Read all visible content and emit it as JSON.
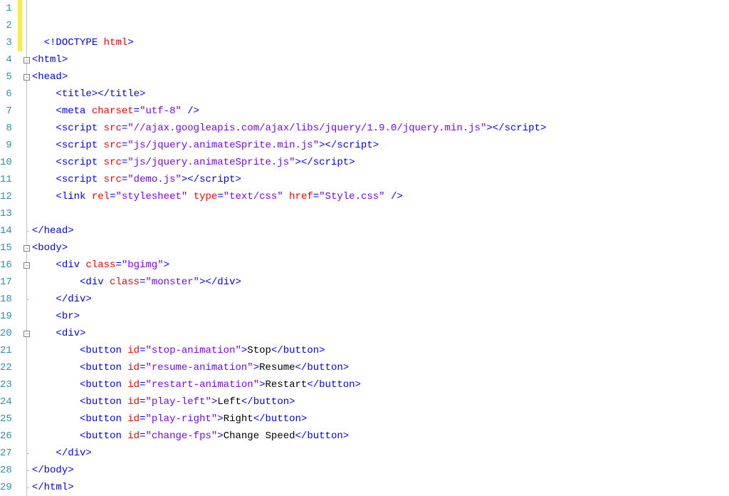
{
  "lines": [
    {
      "num": "1",
      "marker": true,
      "fold": "",
      "tokens": [
        {
          "c": "txt",
          "t": ""
        }
      ]
    },
    {
      "num": "2",
      "marker": true,
      "fold": "",
      "tokens": [
        {
          "c": "txt",
          "t": ""
        }
      ]
    },
    {
      "num": "3",
      "marker": true,
      "fold": "",
      "tokens": [
        {
          "c": "txt",
          "t": "  "
        },
        {
          "c": "doctype1",
          "t": "<!DOCTYPE "
        },
        {
          "c": "doctype2",
          "t": "html"
        },
        {
          "c": "doctype1",
          "t": ">"
        }
      ]
    },
    {
      "num": "4",
      "marker": false,
      "fold": "box",
      "tokens": [
        {
          "c": "tag",
          "t": "<html>"
        }
      ]
    },
    {
      "num": "5",
      "marker": false,
      "fold": "box",
      "tokens": [
        {
          "c": "tag",
          "t": "<head>"
        }
      ]
    },
    {
      "num": "6",
      "marker": false,
      "fold": "",
      "tokens": [
        {
          "c": "txt",
          "t": "    "
        },
        {
          "c": "tag",
          "t": "<title></title>"
        }
      ]
    },
    {
      "num": "7",
      "marker": false,
      "fold": "",
      "tokens": [
        {
          "c": "txt",
          "t": "    "
        },
        {
          "c": "tag",
          "t": "<meta "
        },
        {
          "c": "attr",
          "t": "charset"
        },
        {
          "c": "tag",
          "t": "="
        },
        {
          "c": "val",
          "t": "\"utf-8\""
        },
        {
          "c": "tag",
          "t": " />"
        }
      ]
    },
    {
      "num": "8",
      "marker": false,
      "fold": "",
      "tokens": [
        {
          "c": "txt",
          "t": "    "
        },
        {
          "c": "tag",
          "t": "<script "
        },
        {
          "c": "attr",
          "t": "src"
        },
        {
          "c": "tag",
          "t": "="
        },
        {
          "c": "val",
          "t": "\"//ajax.googleapis.com/ajax/libs/jquery/1.9.0/jquery.min.js\""
        },
        {
          "c": "tag",
          "t": "></script"
        },
        {
          "c": "tag",
          "t": ">"
        }
      ]
    },
    {
      "num": "9",
      "marker": false,
      "fold": "",
      "tokens": [
        {
          "c": "txt",
          "t": "    "
        },
        {
          "c": "tag",
          "t": "<script "
        },
        {
          "c": "attr",
          "t": "src"
        },
        {
          "c": "tag",
          "t": "="
        },
        {
          "c": "val",
          "t": "\"js/jquery.animateSprite.min.js\""
        },
        {
          "c": "tag",
          "t": "></script"
        },
        {
          "c": "tag",
          "t": ">"
        }
      ]
    },
    {
      "num": "10",
      "marker": false,
      "fold": "",
      "tokens": [
        {
          "c": "txt",
          "t": "    "
        },
        {
          "c": "tag",
          "t": "<script "
        },
        {
          "c": "attr",
          "t": "src"
        },
        {
          "c": "tag",
          "t": "="
        },
        {
          "c": "val",
          "t": "\"js/jquery.animateSprite.js\""
        },
        {
          "c": "tag",
          "t": "></script"
        },
        {
          "c": "tag",
          "t": ">"
        }
      ]
    },
    {
      "num": "11",
      "marker": false,
      "fold": "",
      "tokens": [
        {
          "c": "txt",
          "t": "    "
        },
        {
          "c": "tag",
          "t": "<script "
        },
        {
          "c": "attr",
          "t": "src"
        },
        {
          "c": "tag",
          "t": "="
        },
        {
          "c": "val",
          "t": "\"demo.js\""
        },
        {
          "c": "tag",
          "t": "></script"
        },
        {
          "c": "tag",
          "t": ">"
        }
      ]
    },
    {
      "num": "12",
      "marker": false,
      "fold": "",
      "tokens": [
        {
          "c": "txt",
          "t": "    "
        },
        {
          "c": "tag",
          "t": "<link "
        },
        {
          "c": "attr",
          "t": "rel"
        },
        {
          "c": "tag",
          "t": "="
        },
        {
          "c": "val",
          "t": "\"stylesheet\""
        },
        {
          "c": "tag",
          "t": " "
        },
        {
          "c": "attr",
          "t": "type"
        },
        {
          "c": "tag",
          "t": "="
        },
        {
          "c": "val",
          "t": "\"text/css\""
        },
        {
          "c": "tag",
          "t": " "
        },
        {
          "c": "attr",
          "t": "href"
        },
        {
          "c": "tag",
          "t": "="
        },
        {
          "c": "val",
          "t": "\"Style.css\""
        },
        {
          "c": "tag",
          "t": " />"
        }
      ]
    },
    {
      "num": "13",
      "marker": false,
      "fold": "",
      "tokens": [
        {
          "c": "txt",
          "t": ""
        }
      ]
    },
    {
      "num": "14",
      "marker": false,
      "fold": "end",
      "tokens": [
        {
          "c": "tag",
          "t": "</head>"
        }
      ]
    },
    {
      "num": "15",
      "marker": false,
      "fold": "box",
      "tokens": [
        {
          "c": "tag",
          "t": "<body>"
        }
      ]
    },
    {
      "num": "16",
      "marker": false,
      "fold": "box",
      "tokens": [
        {
          "c": "txt",
          "t": "    "
        },
        {
          "c": "tag",
          "t": "<div "
        },
        {
          "c": "attr",
          "t": "class"
        },
        {
          "c": "tag",
          "t": "="
        },
        {
          "c": "val",
          "t": "\"bgimg\""
        },
        {
          "c": "tag",
          "t": ">"
        }
      ]
    },
    {
      "num": "17",
      "marker": false,
      "fold": "",
      "tokens": [
        {
          "c": "txt",
          "t": "        "
        },
        {
          "c": "tag",
          "t": "<div "
        },
        {
          "c": "attr",
          "t": "class"
        },
        {
          "c": "tag",
          "t": "="
        },
        {
          "c": "val",
          "t": "\"monster\""
        },
        {
          "c": "tag",
          "t": "></div>"
        }
      ]
    },
    {
      "num": "18",
      "marker": false,
      "fold": "end",
      "tokens": [
        {
          "c": "txt",
          "t": "    "
        },
        {
          "c": "tag",
          "t": "</div>"
        }
      ]
    },
    {
      "num": "19",
      "marker": false,
      "fold": "",
      "tokens": [
        {
          "c": "txt",
          "t": "    "
        },
        {
          "c": "tag",
          "t": "<br>"
        }
      ]
    },
    {
      "num": "20",
      "marker": false,
      "fold": "box",
      "tokens": [
        {
          "c": "txt",
          "t": "    "
        },
        {
          "c": "tag",
          "t": "<div>"
        }
      ]
    },
    {
      "num": "21",
      "marker": false,
      "fold": "",
      "tokens": [
        {
          "c": "txt",
          "t": "        "
        },
        {
          "c": "tag",
          "t": "<button "
        },
        {
          "c": "attr",
          "t": "id"
        },
        {
          "c": "tag",
          "t": "="
        },
        {
          "c": "val",
          "t": "\"stop-animation\""
        },
        {
          "c": "tag",
          "t": ">"
        },
        {
          "c": "txt",
          "t": "Stop"
        },
        {
          "c": "tag",
          "t": "</button>"
        }
      ]
    },
    {
      "num": "22",
      "marker": false,
      "fold": "",
      "tokens": [
        {
          "c": "txt",
          "t": "        "
        },
        {
          "c": "tag",
          "t": "<button "
        },
        {
          "c": "attr",
          "t": "id"
        },
        {
          "c": "tag",
          "t": "="
        },
        {
          "c": "val",
          "t": "\"resume-animation\""
        },
        {
          "c": "tag",
          "t": ">"
        },
        {
          "c": "txt",
          "t": "Resume"
        },
        {
          "c": "tag",
          "t": "</button>"
        }
      ]
    },
    {
      "num": "23",
      "marker": false,
      "fold": "",
      "tokens": [
        {
          "c": "txt",
          "t": "        "
        },
        {
          "c": "tag",
          "t": "<button "
        },
        {
          "c": "attr",
          "t": "id"
        },
        {
          "c": "tag",
          "t": "="
        },
        {
          "c": "val",
          "t": "\"restart-animation\""
        },
        {
          "c": "tag",
          "t": ">"
        },
        {
          "c": "txt",
          "t": "Restart"
        },
        {
          "c": "tag",
          "t": "</button>"
        }
      ]
    },
    {
      "num": "24",
      "marker": false,
      "fold": "",
      "tokens": [
        {
          "c": "txt",
          "t": "        "
        },
        {
          "c": "tag",
          "t": "<button "
        },
        {
          "c": "attr",
          "t": "id"
        },
        {
          "c": "tag",
          "t": "="
        },
        {
          "c": "val",
          "t": "\"play-left\""
        },
        {
          "c": "tag",
          "t": ">"
        },
        {
          "c": "txt",
          "t": "Left"
        },
        {
          "c": "tag",
          "t": "</button>"
        }
      ]
    },
    {
      "num": "25",
      "marker": false,
      "fold": "",
      "tokens": [
        {
          "c": "txt",
          "t": "        "
        },
        {
          "c": "tag",
          "t": "<button "
        },
        {
          "c": "attr",
          "t": "id"
        },
        {
          "c": "tag",
          "t": "="
        },
        {
          "c": "val",
          "t": "\"play-right\""
        },
        {
          "c": "tag",
          "t": ">"
        },
        {
          "c": "txt",
          "t": "Right"
        },
        {
          "c": "tag",
          "t": "</button>"
        }
      ]
    },
    {
      "num": "26",
      "marker": false,
      "fold": "",
      "tokens": [
        {
          "c": "txt",
          "t": "        "
        },
        {
          "c": "tag",
          "t": "<button "
        },
        {
          "c": "attr",
          "t": "id"
        },
        {
          "c": "tag",
          "t": "="
        },
        {
          "c": "val",
          "t": "\"change-fps\""
        },
        {
          "c": "tag",
          "t": ">"
        },
        {
          "c": "txt",
          "t": "Change Speed"
        },
        {
          "c": "tag",
          "t": "</button>"
        }
      ]
    },
    {
      "num": "27",
      "marker": false,
      "fold": "end",
      "tokens": [
        {
          "c": "txt",
          "t": "    "
        },
        {
          "c": "tag",
          "t": "</div>"
        }
      ]
    },
    {
      "num": "28",
      "marker": false,
      "fold": "end",
      "tokens": [
        {
          "c": "tag",
          "t": "</body>"
        }
      ]
    },
    {
      "num": "29",
      "marker": false,
      "fold": "end",
      "tokens": [
        {
          "c": "tag",
          "t": "</html>"
        }
      ]
    }
  ]
}
